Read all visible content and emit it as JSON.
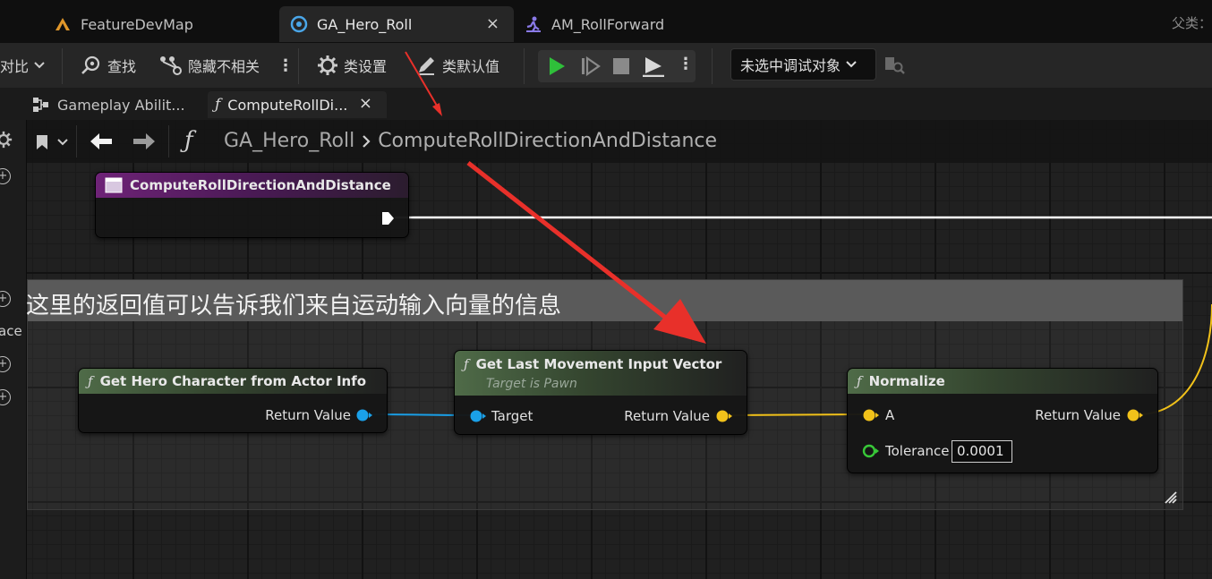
{
  "tabs": [
    {
      "label": "FeatureDevMap",
      "icon": "level-icon"
    },
    {
      "label": "GA_Hero_Roll",
      "icon": "blueprint-icon",
      "active": true
    },
    {
      "label": "AM_RollForward",
      "icon": "anim-montage-icon"
    }
  ],
  "parent_label": "父类：",
  "toolbar": {
    "compare": "对比",
    "find": "查找",
    "hide_unrelated": "隐藏不相关",
    "class_settings": "类设置",
    "class_defaults": "类默认值",
    "debug_object": "未选中调试对象"
  },
  "sub_tabs": [
    {
      "label": "Gameplay Abilit..."
    },
    {
      "label": "ComputeRollDi...",
      "active": true
    }
  ],
  "left_strip_text": "ace",
  "breadcrumb": {
    "root": "GA_Hero_Roll",
    "current": "ComputeRollDirectionAndDistance"
  },
  "comment": "这里的返回值可以告诉我们来自运动输入向量的信息",
  "nodes": {
    "entry": {
      "title": "ComputeRollDirectionAndDistance"
    },
    "get_hero": {
      "title": "Get Hero Character from Actor Info",
      "out": "Return Value"
    },
    "get_last": {
      "title": "Get Last Movement Input Vector",
      "subtitle": "Target is Pawn",
      "in": "Target",
      "out": "Return Value"
    },
    "normalize": {
      "title": "Normalize",
      "in_a": "A",
      "tolerance_label": "Tolerance",
      "tolerance_value": "0.0001",
      "out": "Return Value"
    }
  },
  "colors": {
    "object_pin": "#1aa0e8",
    "vector_pin": "#f2c21a",
    "float_pin": "#38c838",
    "exec_wire": "#ffffff",
    "annotation_arrow": "#e8302a",
    "play_green": "#2fbf3a"
  }
}
